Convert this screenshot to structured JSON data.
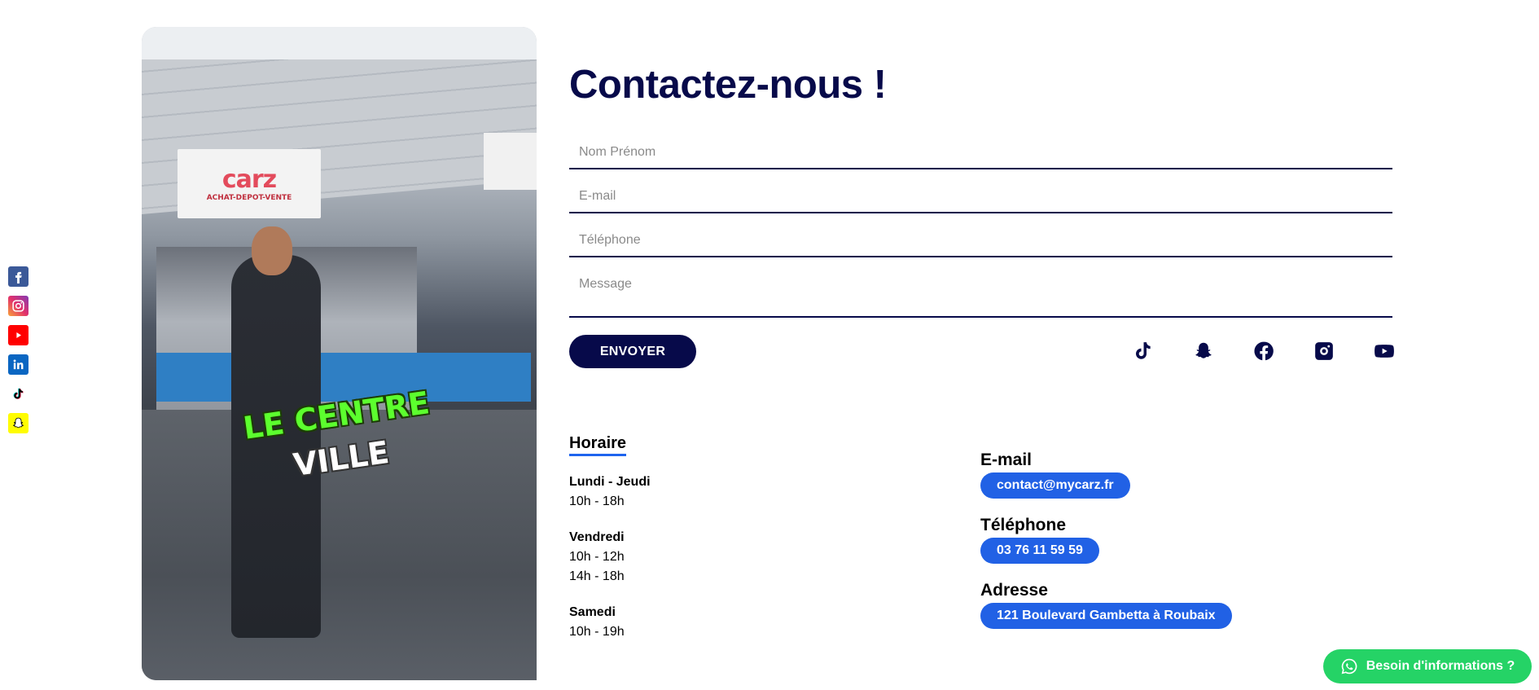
{
  "side_social": [
    {
      "icon": "facebook-icon",
      "color": "#3b5998"
    },
    {
      "icon": "instagram-icon",
      "color": "#c13584"
    },
    {
      "icon": "youtube-icon",
      "color": "#ff0000"
    },
    {
      "icon": "linkedin-icon",
      "color": "#0a66c2"
    },
    {
      "icon": "tiktok-icon",
      "color": "#000000"
    },
    {
      "icon": "snapchat-icon",
      "color": "#fffc00"
    }
  ],
  "media": {
    "banner_brand": "carz",
    "banner_tagline": "ACHAT-DEPOT-VENTE",
    "caption_line1": "LE CENTRE",
    "caption_line2": "VILLE"
  },
  "contact": {
    "title": "Contactez-nous !",
    "fields": {
      "name_placeholder": "Nom Prénom",
      "email_placeholder": "E-mail",
      "phone_placeholder": "Téléphone",
      "message_placeholder": "Message"
    },
    "send_label": "ENVOYER",
    "socials": [
      "tiktok-icon",
      "snapchat-icon",
      "facebook-icon",
      "instagram-icon",
      "youtube-icon"
    ]
  },
  "hours": {
    "title": "Horaire",
    "blocks": [
      {
        "day": "Lundi - Jeudi",
        "times": [
          "10h - 18h"
        ]
      },
      {
        "day": "Vendredi",
        "times": [
          "10h - 12h",
          "14h - 18h"
        ]
      },
      {
        "day": "Samedi",
        "times": [
          "10h - 19h"
        ]
      }
    ]
  },
  "info": {
    "email_label": "E-mail",
    "email_value": "contact@mycarz.fr",
    "phone_label": "Téléphone",
    "phone_value": "03 76 11 59 59",
    "address_label": "Adresse",
    "address_value": "121 Boulevard Gambetta à Roubaix"
  },
  "whatsapp": {
    "label": "Besoin d'informations ?",
    "color": "#25d366"
  },
  "colors": {
    "navy": "#070a4a",
    "accent_blue": "#2161e5"
  }
}
